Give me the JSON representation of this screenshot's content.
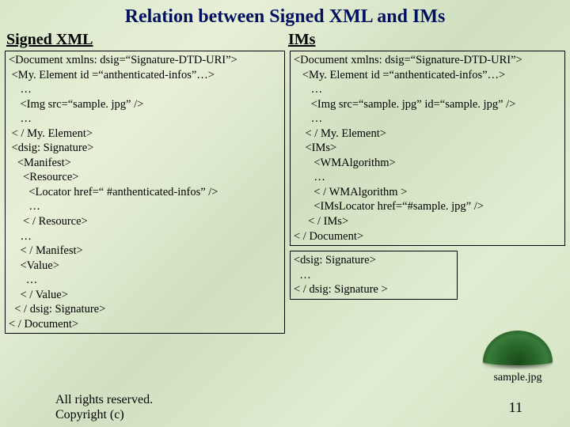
{
  "title": "Relation between Signed XML and IMs",
  "subheads": {
    "left": "Signed XML",
    "right": "IMs"
  },
  "left_code": "<Document xmlns: dsig=“Signature-DTD-URI”>\n <My. Element id =“anthenticated-infos”…>\n    …\n    <Img src=“sample. jpg” />\n    …\n < / My. Element>\n <dsig: Signature>\n   <Manifest>\n     <Resource>\n       <Locator href=“ #anthenticated-infos” />\n       …\n     < / Resource>\n    …\n    < / Manifest>\n    <Value>\n      …\n    < / Value>\n  < / dsig: Signature>\n< / Document>",
  "right_code_top": "<Document xmlns: dsig=“Signature-DTD-URI”>\n   <My. Element id =“anthenticated-infos”…>\n      …\n      <Img src=“sample. jpg” id=“sample. jpg” />\n      …\n    < / My. Element>\n    <IMs>\n       <WMAlgorithm>\n       …\n       < / WMAlgorithm >\n       <IMsLocator href=“#sample. jpg” />\n     < / IMs>\n< / Document>",
  "right_code_bottom": "<dsig: Signature>\n  …\n< / dsig: Signature >",
  "image_caption": "sample.jpg",
  "footer_line1": "All rights reserved.",
  "footer_line2": "Copyright (c)",
  "page_number": "11"
}
